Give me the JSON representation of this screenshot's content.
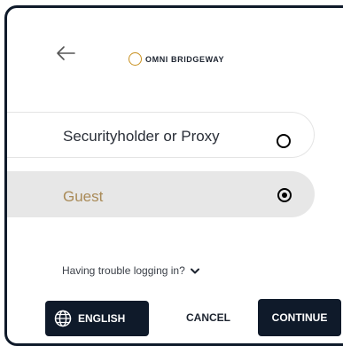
{
  "header": {
    "back_icon": "arrow-left-icon",
    "logo_text": "OMNI BRIDGEWAY",
    "logo_color": "#c8901f"
  },
  "options": [
    {
      "label": "Securityholder or Proxy",
      "selected": false
    },
    {
      "label": "Guest",
      "selected": true
    }
  ],
  "help": {
    "trouble_label": "Having trouble logging in?",
    "chevron_icon": "chevron-down-icon"
  },
  "footer": {
    "language_label": "ENGLISH",
    "language_icon": "globe-icon",
    "cancel_label": "CANCEL",
    "continue_label": "CONTINUE"
  },
  "colors": {
    "primary_dark": "#0f1a2a",
    "selected_bg": "#e7e7e7",
    "selected_text": "#a98a57"
  }
}
